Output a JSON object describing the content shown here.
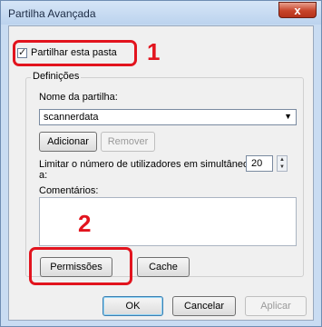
{
  "window": {
    "title": "Partilha Avançada",
    "close_glyph": "x"
  },
  "share": {
    "checkbox_label": "Partilhar esta pasta",
    "checked": true
  },
  "settings": {
    "group_title": "Definições",
    "share_name_label": "Nome da partilha:",
    "share_name_value": "scannerdata",
    "add_label": "Adicionar",
    "remove_label": "Remover",
    "limit_label_line1": "Limitar o número de utilizadores em simultâneo",
    "limit_label_line2": "a:",
    "limit_value": "20",
    "comments_label": "Comentários:",
    "comments_value": ""
  },
  "actions": {
    "permissions_label": "Permissões",
    "cache_label": "Cache"
  },
  "footer": {
    "ok_label": "OK",
    "cancel_label": "Cancelar",
    "apply_label": "Aplicar"
  },
  "callouts": {
    "step1": "1",
    "step2": "2",
    "color": "#e2141e"
  }
}
